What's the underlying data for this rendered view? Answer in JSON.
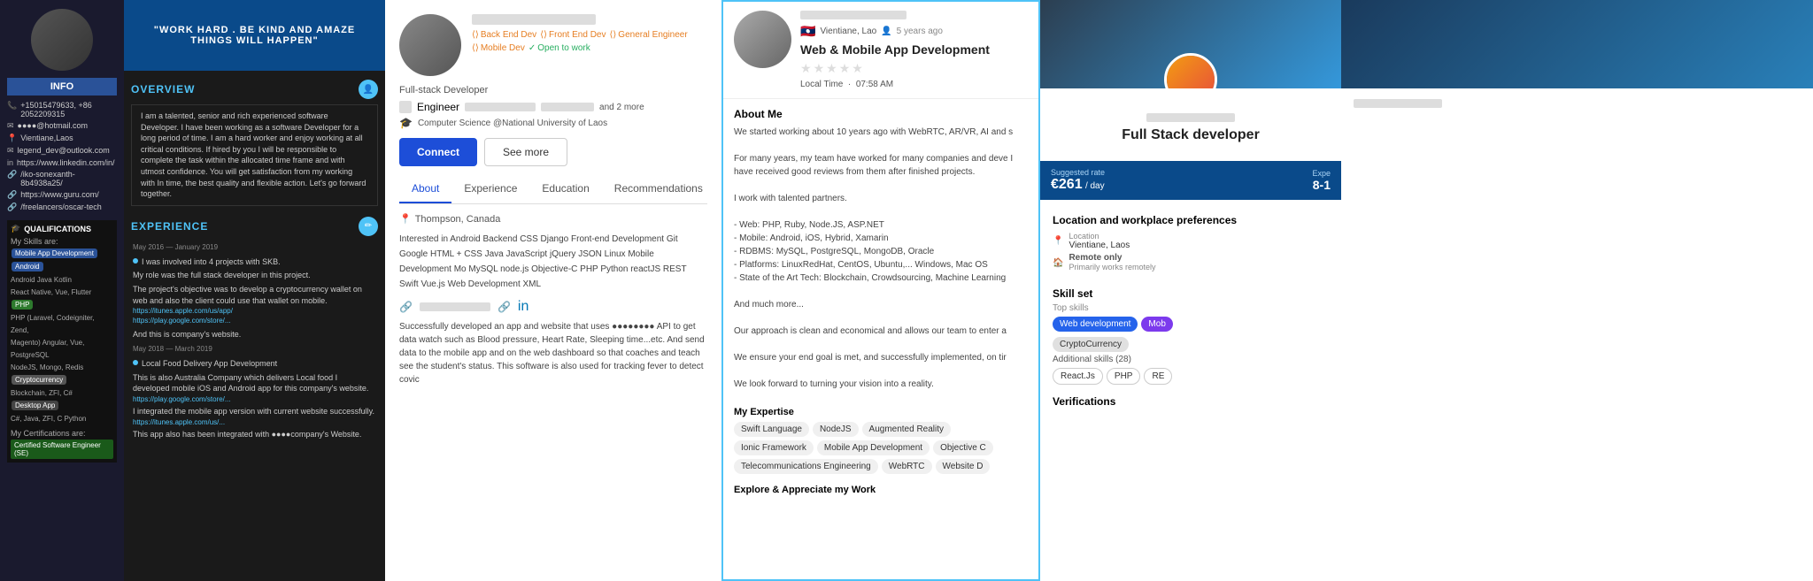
{
  "panel1": {
    "info_label": "INFO",
    "phone": "+15015479633, +86 2052209315",
    "email_blurred": "●●●●@hotmail.com",
    "location": "Vientiane,Laos",
    "email2_blurred": "legend_dev@outlook.com",
    "linkedin": "https://www.linkedin.com/in/",
    "url1": "/iko-sonexanth-8b4938a25/",
    "guru": "https://www.guru.com/",
    "freelancers": "/freelancers/oscar-tech",
    "qualifications_title": "QUALIFICATIONS",
    "skills_label": "My Skills are:",
    "skills": [
      "Mobile App Development",
      "Android",
      "Android Java Kotlin",
      "React Native, Vue, Flutter",
      "PHP",
      "PHP (Laravel, Codeigniter, Zend,",
      "Magento) Angular, Vue, PostgreSQL",
      "NodeJS, Mongo, Redis",
      "Cryptocurrency",
      "Blockchain, ZFI, C#",
      "Desktop App",
      "C#, Java, ZFI, C Python"
    ],
    "certs_label": "My Certifications are:",
    "cert": "Certified Software Engineer (SE)"
  },
  "panel2": {
    "hero_text": "\"WORK HARD . BE KIND AND AMAZE THINGS WILL HAPPEN\"",
    "overview_title": "OVERVIEW",
    "overview_text": "I am a talented, senior and rich experienced software Developer. I have been working as a software Developer for a long period of time. I am a hard worker and enjoy working at all critical conditions. If hired by you I will be responsible to complete the task within the allocated time frame and with utmost confidence. You will get satisfaction from my working with In time, the best quality and flexible action. Let's go forward together.",
    "experience_title": "EXPERIENCE",
    "exp_date1": "May 2016 — January 2019",
    "exp_item1_title": "I was involved into 4 projects with SKB.",
    "exp_item1_desc": "My role was the full stack developer in this project.",
    "exp_item1_detail": "The project's objective was to develop a cryptocurrency wallet on web and also the client could use that wallet on mobile.",
    "links": [
      "https://itunes.apple.com/us/app/",
      "https://play.google.com/store/..."
    ],
    "exp_item1_extra": "And this is company's website.",
    "exp_date2": "May 2018 — March 2019",
    "exp_item2_title": "Local Food Delivery App Development",
    "exp_item2_desc": "This is also Australia Company which delivers Local food I developed mobile iOS and Android app for this company's website.",
    "link2": "https://play.google.com/store/...",
    "exp_item2_detail": "I integrated the mobile app version with current website successfully.",
    "link3": "https://itunes.apple.com/us/...",
    "exp_item2_extra": "This app also has been integrated with ●●●●company's Website."
  },
  "panel3": {
    "name_blurred": "●●●● ●●●●●●●",
    "role_backend": "Back End Dev",
    "role_frontend": "Front End Dev",
    "role_general": "General Engineer",
    "role_mobiledev": "Mobile Dev",
    "open_to_work": "Open to work",
    "subtitle": "Full-stack Developer",
    "engineer_label": "Engineer",
    "university": "Computer Science @National University of Laos",
    "btn_connect": "Connect",
    "btn_seemore": "See more",
    "tab_about": "About",
    "tab_experience": "Experience",
    "tab_education": "Education",
    "tab_recommendations": "Recommendations",
    "location": "Thompson, Canada",
    "skills_text": "Interested in Android Backend CSS Django Front-end Development Git Google HTML + CSS Java JavaScript jQuery JSON Linux Mobile Development Mo MySQL node.js Objective-C PHP Python reactJS REST Swift Vue.js Web Development XML",
    "social_link_label": "●●●●●●●●●",
    "success_text": "Successfully developed an app and website that uses ●●●●●●●● API to get data watch such as Blood pressure, Heart Rate, Sleeping time...etc. And send data to the mobile app and on the web dashboard so that coaches and teach see the student's status. This software is also used for tracking fever to detect covic"
  },
  "panel4": {
    "name_blurred": "●●●● ●●●●●●",
    "location_text": "Vientiane, Lao",
    "flag_emoji": "🇱🇦",
    "years_ago": "5 years ago",
    "profile_title": "Web & Mobile App Development",
    "local_time_label": "Local Time",
    "local_time_value": "07:58 AM",
    "about_title": "About Me",
    "about_paragraphs": [
      "We started working about 10 years ago with WebRTC, AR/VR, AI and s",
      "For many years, my team have worked for many companies and deve I have received good reviews from them after finished projects.",
      "I work with talented partners.",
      "- Web: PHP, Ruby, Node.JS, ASP.NET",
      "- Mobile: Android, iOS, Hybrid, Xamarin",
      "- RDBMS: MySQL, PostgreSQL, MongoDB, Oracle",
      "- Platforms: LinuxRedHat, CentOS, Ubuntu,... Windows, Mac OS",
      "- State of the Art Tech: Blockchain, Crowdsourcing, Machine Learning",
      "And much more...",
      "Our approach is clean and economical and allows our team to enter a",
      "We ensure your end goal is met, and successfully implemented, on tir",
      "We look forward to turning your vision into a reality."
    ],
    "my_expertise_title": "My Expertise",
    "expertise_tags": [
      "Swift Language",
      "NodeJS",
      "Augmented Reality",
      "Ionic Framework",
      "Mobile App Development",
      "Objective C",
      "Telecommunications Engineering",
      "WebRTC",
      "Website D"
    ],
    "explore_title": "Explore & Appreciate my Work"
  },
  "panel5": {
    "name_blurred": "●●●● ●●●●●●",
    "dev_title": "Full Stack developer",
    "suggested_rate_label": "Suggested rate",
    "rate_value": "€261",
    "rate_period": "/ day",
    "exp_label": "Expe",
    "exp_value": "8-1",
    "location_prefs_title": "Location and workplace preferences",
    "location_label": "Location",
    "location_value": "Vientiane, Laos",
    "remote_label": "Remote only",
    "remote_sub": "Primarily works remotely",
    "skillset_title": "Skill set",
    "top_skills_label": "Top skills",
    "top_skills": [
      "Web development",
      "Mob"
    ],
    "crypto_skill": "CryptoCurrency",
    "additional_skills_label": "Additional skills (28)",
    "additional_skills": [
      "React.Js",
      "PHP",
      "RE"
    ],
    "verifications_title": "Verifications"
  }
}
